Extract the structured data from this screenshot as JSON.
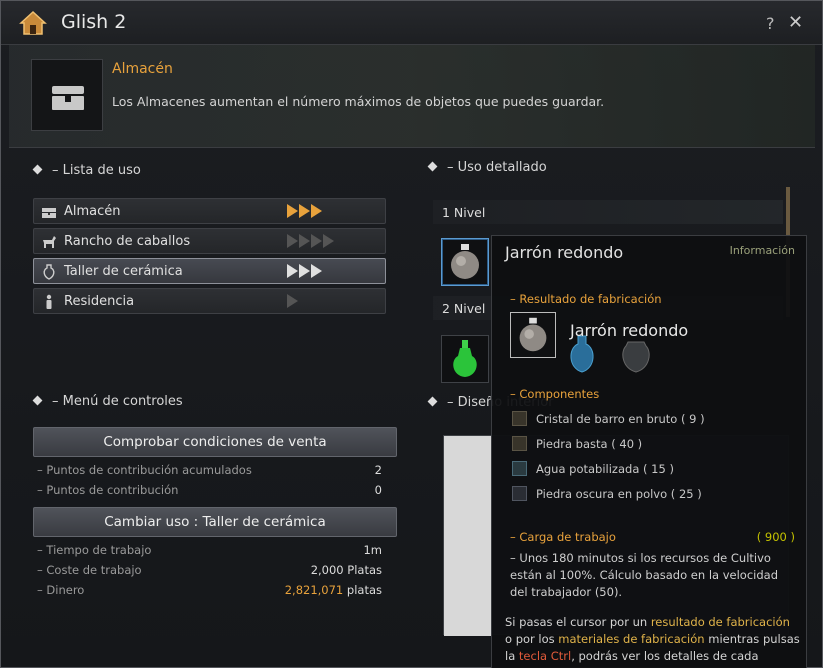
{
  "window": {
    "title": "Glish 2",
    "help_glyph": "?",
    "close_glyph": "✕"
  },
  "banner": {
    "title": "Almacén",
    "description": "Los Almacenes aumentan el número máximos de objetos que puedes guardar."
  },
  "usage_list": {
    "heading": "– Lista de uso",
    "items": [
      {
        "label": "Almacén",
        "icon": "chest-icon",
        "level": 3,
        "max": 3
      },
      {
        "label": "Rancho de caballos",
        "icon": "horse-icon",
        "level": 0,
        "max": 4
      },
      {
        "label": "Taller de cerámica",
        "icon": "vase-icon",
        "level": 3,
        "max": 3
      },
      {
        "label": "Residencia",
        "icon": "person-icon",
        "level": 0,
        "max": 1
      }
    ]
  },
  "detail": {
    "heading": "– Uso detallado",
    "level1": "1 Nivel",
    "level2": "2 Nivel"
  },
  "controls": {
    "heading": "– Menú de controles",
    "check_button": "Comprobar condiciones de venta",
    "rows1": [
      {
        "label": "– Puntos de contribución acumulados",
        "value": "2"
      },
      {
        "label": "– Puntos de contribución",
        "value": "0"
      }
    ],
    "change_button": "Cambiar uso : Taller de cerámica",
    "rows2": [
      {
        "label": "– Tiempo de trabajo",
        "value": "1m"
      },
      {
        "label": "– Coste de trabajo",
        "value": "2,000 Platas"
      }
    ],
    "money_label": "– Dinero",
    "money_value": "2,821,071",
    "money_unit": " platas"
  },
  "interior": {
    "heading": "– Diseño interior"
  },
  "tooltip": {
    "name": "Jarrón redondo",
    "info": "Información",
    "result_heading": "– Resultado de fabricación",
    "product_name": "Jarrón redondo",
    "components_heading": "– Componentes",
    "components": [
      "Cristal de barro en bruto ( 9 )",
      "Piedra basta ( 40 )",
      "Agua potabilizada ( 15 )",
      "Piedra oscura en polvo ( 25 )"
    ],
    "workload_label": "– Carga de trabajo",
    "workload_value": "( 900 )",
    "workload_desc": "– Unos 180 minutos si los recursos de Cultivo están al 100%. Cálculo basado en la velocidad del trabajador (50).",
    "hint": {
      "p1": "Si pasas el cursor por un ",
      "h1": "resultado de fabricación",
      "p2": " o por los ",
      "h2": "materiales de fabricación",
      "p3": " mientras pulsas la ",
      "h3": "tecla Ctrl",
      "p4": ", podrás ver los detalles de cada objeto."
    }
  },
  "colors": {
    "accent": "#e8a23c",
    "workload_number": "#c4c200",
    "ctrl_highlight": "#e05a3a"
  }
}
